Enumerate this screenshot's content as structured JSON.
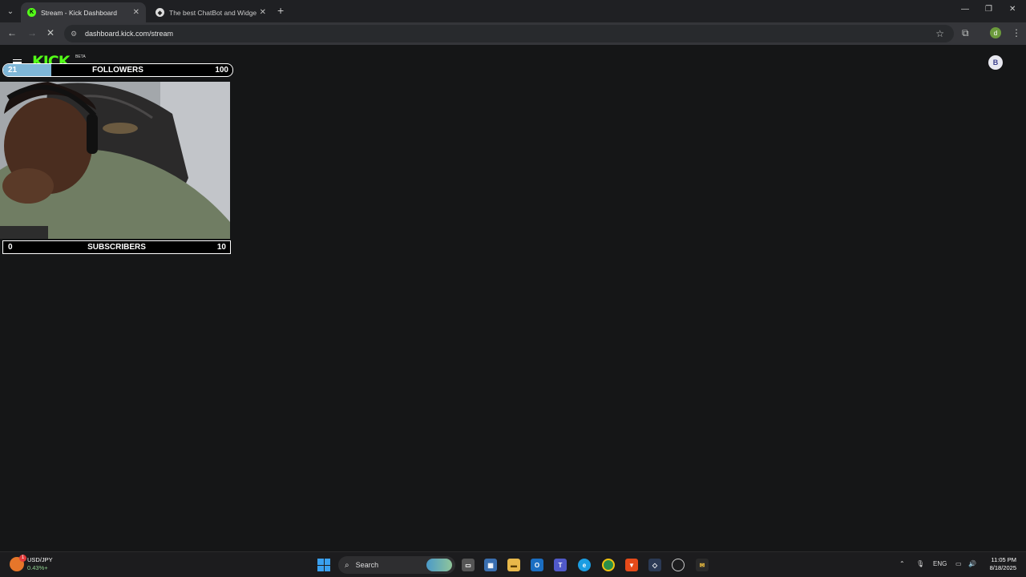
{
  "browser": {
    "tabs": [
      {
        "title": "Stream - Kick Dashboard",
        "active": true
      },
      {
        "title": "The best ChatBot and Widgets",
        "active": false
      }
    ],
    "url": "dashboard.kick.com/stream",
    "profile_initial": "d"
  },
  "page": {
    "brand": "KICK",
    "brand_tag": "BETA"
  },
  "overlay": {
    "followers": {
      "label": "FOLLOWERS",
      "current": "21",
      "target": "100",
      "progress": 0.21
    },
    "subscribers": {
      "label": "SUBSCRIBERS",
      "current": "0",
      "target": "10",
      "progress": 0.0
    }
  },
  "taskbar": {
    "ticker_symbol": "USD/JPY",
    "ticker_change": "0.43%+",
    "search_placeholder": "Search",
    "language": "ENG",
    "time": "11:05 PM",
    "date": "8/18/2025"
  }
}
